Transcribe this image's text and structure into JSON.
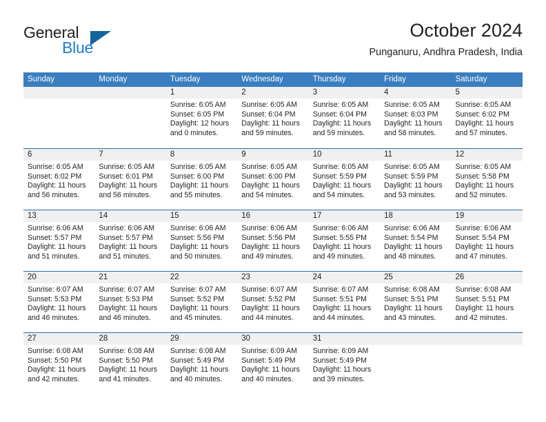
{
  "brand": {
    "name_top": "General",
    "name_bottom": "Blue",
    "accent_color": "#1e7ad1",
    "triangle_color": "#15659f"
  },
  "header": {
    "title": "October 2024",
    "subtitle": "Punganuru, Andhra Pradesh, India"
  },
  "calendar": {
    "header_background": "#3a7ebf",
    "day_band_background": "#f0f0f0",
    "week_separator_color": "#2d6ca8",
    "weekdays": [
      "Sunday",
      "Monday",
      "Tuesday",
      "Wednesday",
      "Thursday",
      "Friday",
      "Saturday"
    ],
    "weeks": [
      [
        {
          "day": "",
          "sunrise": "",
          "sunset": "",
          "daylight_line1": "",
          "daylight_line2": ""
        },
        {
          "day": "",
          "sunrise": "",
          "sunset": "",
          "daylight_line1": "",
          "daylight_line2": ""
        },
        {
          "day": "1",
          "sunrise": "Sunrise: 6:05 AM",
          "sunset": "Sunset: 6:05 PM",
          "daylight_line1": "Daylight: 12 hours",
          "daylight_line2": "and 0 minutes."
        },
        {
          "day": "2",
          "sunrise": "Sunrise: 6:05 AM",
          "sunset": "Sunset: 6:04 PM",
          "daylight_line1": "Daylight: 11 hours",
          "daylight_line2": "and 59 minutes."
        },
        {
          "day": "3",
          "sunrise": "Sunrise: 6:05 AM",
          "sunset": "Sunset: 6:04 PM",
          "daylight_line1": "Daylight: 11 hours",
          "daylight_line2": "and 59 minutes."
        },
        {
          "day": "4",
          "sunrise": "Sunrise: 6:05 AM",
          "sunset": "Sunset: 6:03 PM",
          "daylight_line1": "Daylight: 11 hours",
          "daylight_line2": "and 58 minutes."
        },
        {
          "day": "5",
          "sunrise": "Sunrise: 6:05 AM",
          "sunset": "Sunset: 6:02 PM",
          "daylight_line1": "Daylight: 11 hours",
          "daylight_line2": "and 57 minutes."
        }
      ],
      [
        {
          "day": "6",
          "sunrise": "Sunrise: 6:05 AM",
          "sunset": "Sunset: 6:02 PM",
          "daylight_line1": "Daylight: 11 hours",
          "daylight_line2": "and 56 minutes."
        },
        {
          "day": "7",
          "sunrise": "Sunrise: 6:05 AM",
          "sunset": "Sunset: 6:01 PM",
          "daylight_line1": "Daylight: 11 hours",
          "daylight_line2": "and 56 minutes."
        },
        {
          "day": "8",
          "sunrise": "Sunrise: 6:05 AM",
          "sunset": "Sunset: 6:00 PM",
          "daylight_line1": "Daylight: 11 hours",
          "daylight_line2": "and 55 minutes."
        },
        {
          "day": "9",
          "sunrise": "Sunrise: 6:05 AM",
          "sunset": "Sunset: 6:00 PM",
          "daylight_line1": "Daylight: 11 hours",
          "daylight_line2": "and 54 minutes."
        },
        {
          "day": "10",
          "sunrise": "Sunrise: 6:05 AM",
          "sunset": "Sunset: 5:59 PM",
          "daylight_line1": "Daylight: 11 hours",
          "daylight_line2": "and 54 minutes."
        },
        {
          "day": "11",
          "sunrise": "Sunrise: 6:05 AM",
          "sunset": "Sunset: 5:59 PM",
          "daylight_line1": "Daylight: 11 hours",
          "daylight_line2": "and 53 minutes."
        },
        {
          "day": "12",
          "sunrise": "Sunrise: 6:05 AM",
          "sunset": "Sunset: 5:58 PM",
          "daylight_line1": "Daylight: 11 hours",
          "daylight_line2": "and 52 minutes."
        }
      ],
      [
        {
          "day": "13",
          "sunrise": "Sunrise: 6:06 AM",
          "sunset": "Sunset: 5:57 PM",
          "daylight_line1": "Daylight: 11 hours",
          "daylight_line2": "and 51 minutes."
        },
        {
          "day": "14",
          "sunrise": "Sunrise: 6:06 AM",
          "sunset": "Sunset: 5:57 PM",
          "daylight_line1": "Daylight: 11 hours",
          "daylight_line2": "and 51 minutes."
        },
        {
          "day": "15",
          "sunrise": "Sunrise: 6:06 AM",
          "sunset": "Sunset: 5:56 PM",
          "daylight_line1": "Daylight: 11 hours",
          "daylight_line2": "and 50 minutes."
        },
        {
          "day": "16",
          "sunrise": "Sunrise: 6:06 AM",
          "sunset": "Sunset: 5:56 PM",
          "daylight_line1": "Daylight: 11 hours",
          "daylight_line2": "and 49 minutes."
        },
        {
          "day": "17",
          "sunrise": "Sunrise: 6:06 AM",
          "sunset": "Sunset: 5:55 PM",
          "daylight_line1": "Daylight: 11 hours",
          "daylight_line2": "and 49 minutes."
        },
        {
          "day": "18",
          "sunrise": "Sunrise: 6:06 AM",
          "sunset": "Sunset: 5:54 PM",
          "daylight_line1": "Daylight: 11 hours",
          "daylight_line2": "and 48 minutes."
        },
        {
          "day": "19",
          "sunrise": "Sunrise: 6:06 AM",
          "sunset": "Sunset: 5:54 PM",
          "daylight_line1": "Daylight: 11 hours",
          "daylight_line2": "and 47 minutes."
        }
      ],
      [
        {
          "day": "20",
          "sunrise": "Sunrise: 6:07 AM",
          "sunset": "Sunset: 5:53 PM",
          "daylight_line1": "Daylight: 11 hours",
          "daylight_line2": "and 46 minutes."
        },
        {
          "day": "21",
          "sunrise": "Sunrise: 6:07 AM",
          "sunset": "Sunset: 5:53 PM",
          "daylight_line1": "Daylight: 11 hours",
          "daylight_line2": "and 46 minutes."
        },
        {
          "day": "22",
          "sunrise": "Sunrise: 6:07 AM",
          "sunset": "Sunset: 5:52 PM",
          "daylight_line1": "Daylight: 11 hours",
          "daylight_line2": "and 45 minutes."
        },
        {
          "day": "23",
          "sunrise": "Sunrise: 6:07 AM",
          "sunset": "Sunset: 5:52 PM",
          "daylight_line1": "Daylight: 11 hours",
          "daylight_line2": "and 44 minutes."
        },
        {
          "day": "24",
          "sunrise": "Sunrise: 6:07 AM",
          "sunset": "Sunset: 5:51 PM",
          "daylight_line1": "Daylight: 11 hours",
          "daylight_line2": "and 44 minutes."
        },
        {
          "day": "25",
          "sunrise": "Sunrise: 6:08 AM",
          "sunset": "Sunset: 5:51 PM",
          "daylight_line1": "Daylight: 11 hours",
          "daylight_line2": "and 43 minutes."
        },
        {
          "day": "26",
          "sunrise": "Sunrise: 6:08 AM",
          "sunset": "Sunset: 5:51 PM",
          "daylight_line1": "Daylight: 11 hours",
          "daylight_line2": "and 42 minutes."
        }
      ],
      [
        {
          "day": "27",
          "sunrise": "Sunrise: 6:08 AM",
          "sunset": "Sunset: 5:50 PM",
          "daylight_line1": "Daylight: 11 hours",
          "daylight_line2": "and 42 minutes."
        },
        {
          "day": "28",
          "sunrise": "Sunrise: 6:08 AM",
          "sunset": "Sunset: 5:50 PM",
          "daylight_line1": "Daylight: 11 hours",
          "daylight_line2": "and 41 minutes."
        },
        {
          "day": "29",
          "sunrise": "Sunrise: 6:08 AM",
          "sunset": "Sunset: 5:49 PM",
          "daylight_line1": "Daylight: 11 hours",
          "daylight_line2": "and 40 minutes."
        },
        {
          "day": "30",
          "sunrise": "Sunrise: 6:09 AM",
          "sunset": "Sunset: 5:49 PM",
          "daylight_line1": "Daylight: 11 hours",
          "daylight_line2": "and 40 minutes."
        },
        {
          "day": "31",
          "sunrise": "Sunrise: 6:09 AM",
          "sunset": "Sunset: 5:49 PM",
          "daylight_line1": "Daylight: 11 hours",
          "daylight_line2": "and 39 minutes."
        },
        {
          "day": "",
          "sunrise": "",
          "sunset": "",
          "daylight_line1": "",
          "daylight_line2": ""
        },
        {
          "day": "",
          "sunrise": "",
          "sunset": "",
          "daylight_line1": "",
          "daylight_line2": ""
        }
      ]
    ]
  }
}
